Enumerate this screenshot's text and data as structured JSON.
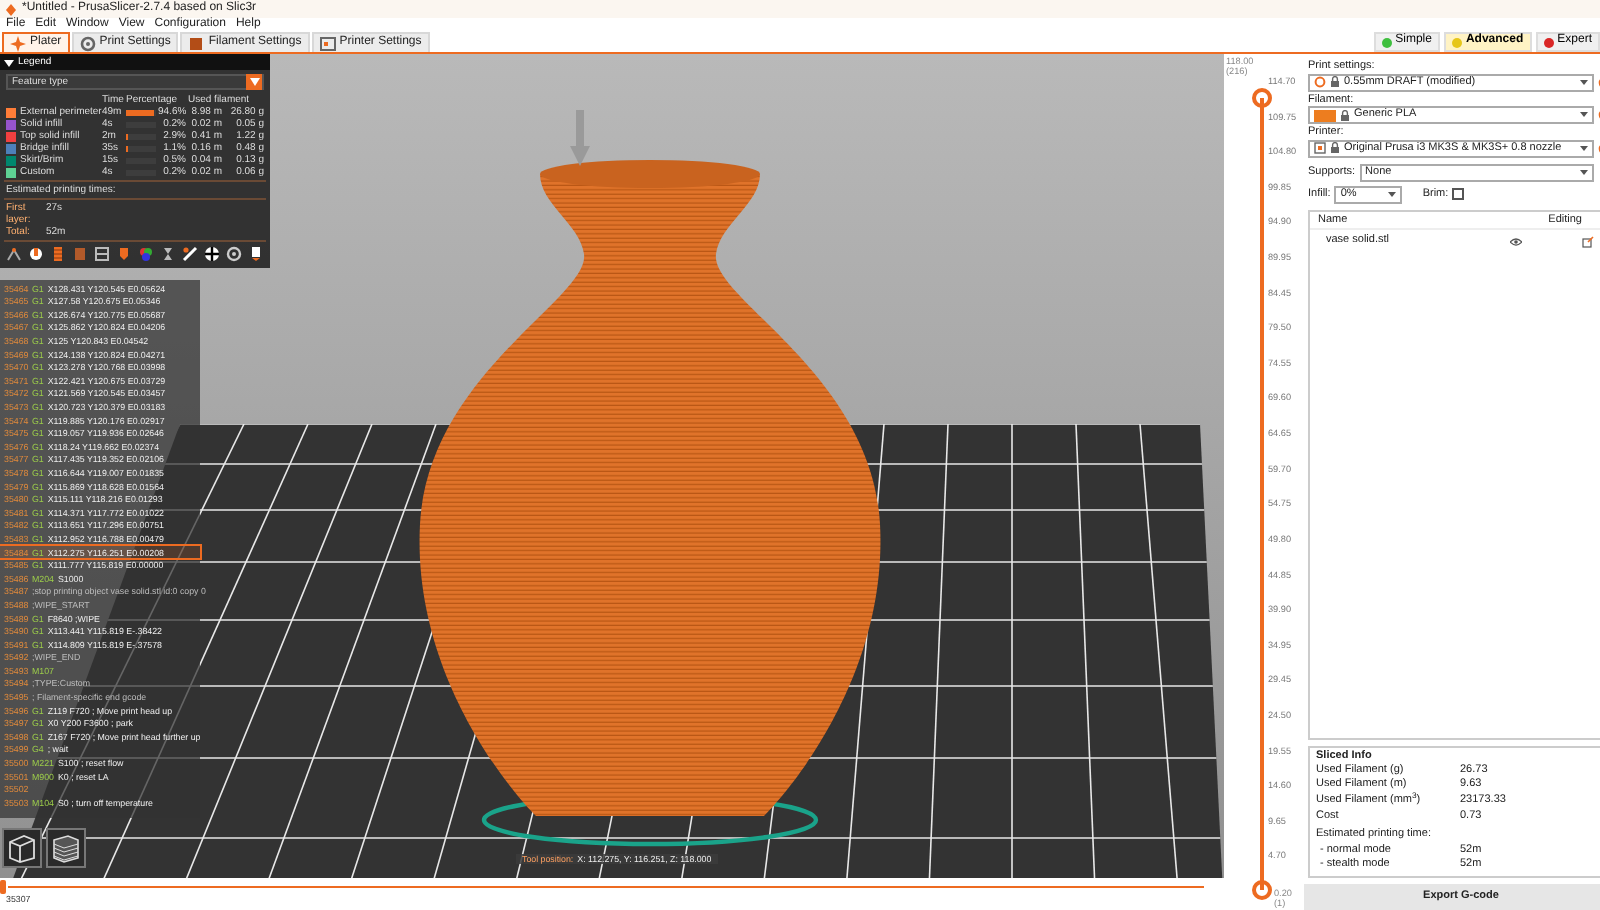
{
  "window": {
    "title": "*Untitled - PrusaSlicer-2.7.4 based on Slic3r"
  },
  "menu": [
    "File",
    "Edit",
    "Window",
    "View",
    "Configuration",
    "Help"
  ],
  "tabs": [
    {
      "label": "Plater",
      "kind": "plater",
      "selected": true
    },
    {
      "label": "Print Settings",
      "kind": "print",
      "selected": false
    },
    {
      "label": "Filament Settings",
      "kind": "filament",
      "selected": false
    },
    {
      "label": "Printer Settings",
      "kind": "printer",
      "selected": false
    }
  ],
  "modes": [
    {
      "label": "Simple",
      "color": "#3fbf3f",
      "selected": false
    },
    {
      "label": "Advanced",
      "color": "#e6c619",
      "selected": true
    },
    {
      "label": "Expert",
      "color": "#d92626",
      "selected": false
    }
  ],
  "legend": {
    "title": "Legend",
    "expanded": true,
    "view_type": "Feature type",
    "columns": [
      "Time",
      "Percentage",
      "Used filament"
    ],
    "rows": [
      {
        "name": "External perimeter",
        "color": "#ff7d38",
        "time": "49m",
        "level": 0.946,
        "percentage": "94.6%",
        "length": "8.98 m",
        "weight": "26.80 g"
      },
      {
        "name": "Solid infill",
        "color": "#9654cc",
        "time": "4s",
        "level": 0.002,
        "percentage": "0.2%",
        "length": "0.02 m",
        "weight": "0.05 g"
      },
      {
        "name": "Top solid infill",
        "color": "#f04040",
        "time": "2m",
        "level": 0.029,
        "percentage": "2.9%",
        "length": "0.41 m",
        "weight": "1.22 g"
      },
      {
        "name": "Bridge infill",
        "color": "#4d80ba",
        "time": "35s",
        "level": 0.011,
        "percentage": "1.1%",
        "length": "0.16 m",
        "weight": "0.48 g"
      },
      {
        "name": "Skirt/Brim",
        "color": "#00876e",
        "time": "15s",
        "level": 0.005,
        "percentage": "0.5%",
        "length": "0.04 m",
        "weight": "0.13 g"
      },
      {
        "name": "Custom",
        "color": "#5ed194",
        "time": "4s",
        "level": 0.002,
        "percentage": "0.2%",
        "length": "0.02 m",
        "weight": "0.06 g"
      }
    ],
    "estimated_title": "Estimated printing times:",
    "times": [
      {
        "label": "First layer:",
        "value": "27s"
      },
      {
        "label": "Total:",
        "value": "52m"
      }
    ]
  },
  "gcode": [
    {
      "number": "35464",
      "command": "G1",
      "text": "X128.431 Y120.545 E0.05624",
      "selected": false
    },
    {
      "number": "35465",
      "command": "G1",
      "text": "X127.58 Y120.675 E0.05346",
      "selected": false
    },
    {
      "number": "35466",
      "command": "G1",
      "text": "X126.674 Y120.775 E0.05687",
      "selected": false
    },
    {
      "number": "35467",
      "command": "G1",
      "text": "X125.862 Y120.824 E0.04206",
      "selected": false
    },
    {
      "number": "35468",
      "command": "G1",
      "text": "X125 Y120.843 E0.04542",
      "selected": false
    },
    {
      "number": "35469",
      "command": "G1",
      "text": "X124.138 Y120.824 E0.04271",
      "selected": false
    },
    {
      "number": "35470",
      "command": "G1",
      "text": "X123.278 Y120.768 E0.03998",
      "selected": false
    },
    {
      "number": "35471",
      "command": "G1",
      "text": "X122.421 Y120.675 E0.03729",
      "selected": false
    },
    {
      "number": "35472",
      "command": "G1",
      "text": "X121.569 Y120.545 E0.03457",
      "selected": false
    },
    {
      "number": "35473",
      "command": "G1",
      "text": "X120.723 Y120.379 E0.03183",
      "selected": false
    },
    {
      "number": "35474",
      "command": "G1",
      "text": "X119.885 Y120.176 E0.02917",
      "selected": false
    },
    {
      "number": "35475",
      "command": "G1",
      "text": "X119.057 Y119.936 E0.02646",
      "selected": false
    },
    {
      "number": "35476",
      "command": "G1",
      "text": "X118.24 Y119.662 E0.02374",
      "selected": false
    },
    {
      "number": "35477",
      "command": "G1",
      "text": "X117.435 Y119.352 E0.02106",
      "selected": false
    },
    {
      "number": "35478",
      "command": "G1",
      "text": "X116.644 Y119.007 E0.01835",
      "selected": false
    },
    {
      "number": "35479",
      "command": "G1",
      "text": "X115.869 Y118.628 E0.01564",
      "selected": false
    },
    {
      "number": "35480",
      "command": "G1",
      "text": "X115.111 Y118.216 E0.01293",
      "selected": false
    },
    {
      "number": "35481",
      "command": "G1",
      "text": "X114.371 Y117.772 E0.01022",
      "selected": false
    },
    {
      "number": "35482",
      "command": "G1",
      "text": "X113.651 Y117.296 E0.00751",
      "selected": false
    },
    {
      "number": "35483",
      "command": "G1",
      "text": "X112.952 Y116.788 E0.00479",
      "selected": false
    },
    {
      "number": "35484",
      "command": "G1",
      "text": "X112.275 Y116.251 E0.00208",
      "selected": true
    },
    {
      "number": "35485",
      "command": "G1",
      "text": "X111.777 Y115.819 E0.00000",
      "selected": false
    },
    {
      "number": "35486",
      "command": "M204",
      "text": "S1000",
      "selected": false
    },
    {
      "number": "35487",
      "text": ";stop printing object vase solid.stl id:0 copy 0",
      "selected": false
    },
    {
      "number": "35488",
      "text": ";WIPE_START",
      "selected": false
    },
    {
      "number": "35489",
      "command": "G1",
      "text": "F8640 ;WIPE",
      "selected": false
    },
    {
      "number": "35490",
      "command": "G1",
      "text": "X113.441 Y115.819 E-.38422",
      "selected": false
    },
    {
      "number": "35491",
      "command": "G1",
      "text": "X114.809 Y115.819 E-.37578",
      "selected": false
    },
    {
      "number": "35492",
      "text": ";WIPE_END",
      "selected": false
    },
    {
      "number": "35493",
      "command": "M107",
      "selected": false
    },
    {
      "number": "35494",
      "text": ";TYPE:Custom",
      "selected": false
    },
    {
      "number": "35495",
      "text": "; Filament-specific end gcode",
      "selected": false
    },
    {
      "number": "35496",
      "command": "G1",
      "text": "Z119 F720 ; Move print head up",
      "selected": false
    },
    {
      "number": "35497",
      "command": "G1",
      "text": "X0 Y200 F3600 ; park",
      "selected": false
    },
    {
      "number": "35498",
      "command": "G1",
      "text": "Z167 F720 ; Move print head further up",
      "selected": false
    },
    {
      "number": "35499",
      "command": "G4",
      "text": "; wait",
      "selected": false
    },
    {
      "number": "35500",
      "command": "M221",
      "text": "S100 ; reset flow",
      "selected": false
    },
    {
      "number": "35501",
      "command": "M900",
      "text": "K0 ; reset LA",
      "selected": false
    },
    {
      "number": "35502",
      "selected": false
    },
    {
      "number": "35503",
      "command": "M104",
      "text": "S0 ; turn off temperature",
      "selected": false
    }
  ],
  "horizontal_slider": {
    "position_title": "Tool position:",
    "position_label": "X: 112.275, Y: 116.251, Z: 118.000",
    "start_value": "35307",
    "level": 0
  },
  "vertical_slider": {
    "top_value": "118.00",
    "top_layer": "(216)",
    "bottom_value": "0.20",
    "bottom_layer": "(1)",
    "ticks": [
      "114.70",
      "109.75",
      "104.80",
      "99.85",
      "94.90",
      "89.95",
      "84.45",
      "79.50",
      "74.55",
      "69.60",
      "64.65",
      "59.70",
      "54.75",
      "49.80",
      "44.85",
      "39.90",
      "34.95",
      "29.45",
      "24.50",
      "19.55",
      "14.60",
      "9.65",
      "4.70"
    ],
    "thumbs": [
      {
        "level": 1
      },
      {
        "level": 0
      }
    ]
  },
  "sidebar": {
    "print_label": "Print settings:",
    "print_profile": "0.55mm DRAFT (modified)",
    "filament_label": "Filament:",
    "filament_profile": "Generic PLA",
    "printer_label": "Printer:",
    "printer_profile": "Original Prusa i3 MK3S & MK3S+ 0.8 nozzle",
    "supports_label": "Supports:",
    "supports_value": "None",
    "infill_label": "Infill:",
    "infill_value": "0%",
    "brim_label": "Brim:",
    "brim_checked": false,
    "object_columns": [
      "Name",
      "Editing"
    ],
    "objects": [
      {
        "name": "vase solid.stl",
        "selected": false
      }
    ]
  },
  "sliced_info": {
    "title": "Sliced Info",
    "rows": [
      {
        "label": "Used Filament (g)",
        "value": "26.73"
      },
      {
        "label": "Used Filament (m)",
        "value": "9.63"
      },
      {
        "label": "Used Filament (mm$^{3}$)",
        "value": "23173.33"
      },
      {
        "label": "Cost",
        "value": "0.73"
      }
    ],
    "time_title": "Estimated printing time:",
    "time_rows": [
      {
        "label": "- normal mode",
        "value": "52m"
      },
      {
        "label": "- stealth mode",
        "value": "52m"
      }
    ]
  },
  "export_button": "Export G-code"
}
